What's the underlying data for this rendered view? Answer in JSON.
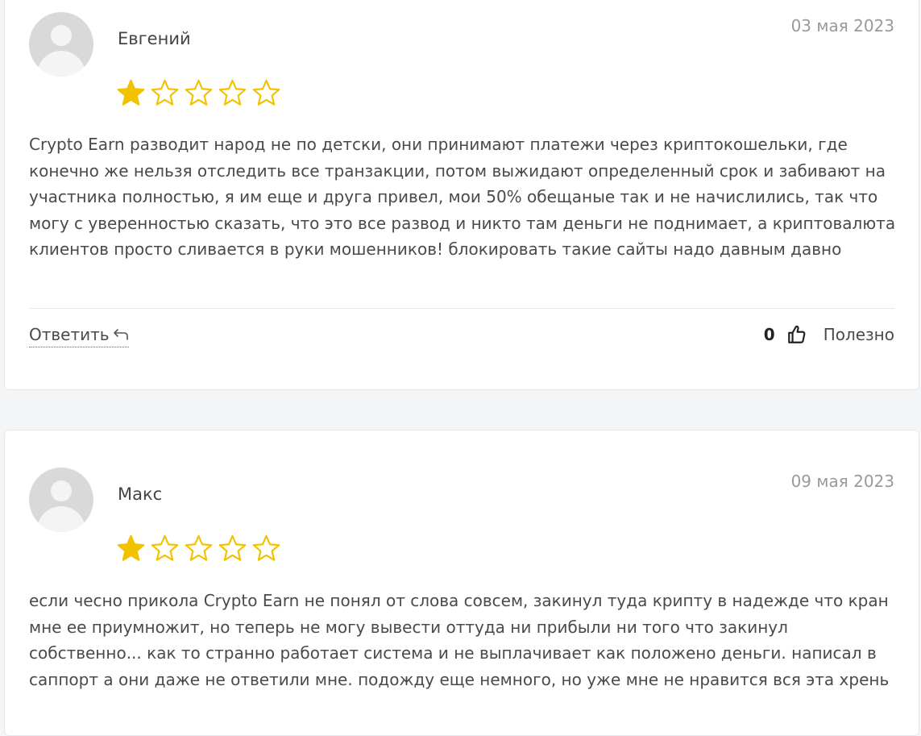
{
  "reviews": [
    {
      "author": "Евгений",
      "date": "03 мая 2023",
      "rating": 1,
      "rating_max": 5,
      "text": "Crypto Earn разводит народ не по детски, они принимают платежи через криптокошельки, где конечно же нельзя отследить все транзакции, потом выжидают определенный срок и забивают на участника полностью, я им еще и друга привел, мои 50% обещаные так и не начислились, так что могу с уверенностью сказать, что это все развод и никто там деньги не поднимает, а криптовалюта клиентов просто сливается в руки мошенников! блокировать такие сайты надо давным давно",
      "reply_label": "Ответить",
      "helpful_count": "0",
      "helpful_label": "Полезно"
    },
    {
      "author": "Макс",
      "date": "09 мая 2023",
      "rating": 1,
      "rating_max": 5,
      "text": "если чесно прикола Crypto Earn не понял от слова совсем, закинул туда крипту в надежде что кран мне ее приумножит, но теперь не могу вывести оттуда ни прибыли ни того что закинул собственно... как то странно работает система и не выплачивает как положено деньги. написал в саппорт а они даже не ответили мне. подожду еще немного, но уже мне не нравится вся эта хрень"
    }
  ],
  "colors": {
    "star_filled": "#f2c200",
    "star_outline": "#f2c200",
    "date_text": "#9a9a9a"
  },
  "icons": {
    "avatar": "user-placeholder-icon",
    "reply": "reply-arrow-icon",
    "helpful": "thumbs-up-icon",
    "star": "star-icon"
  }
}
